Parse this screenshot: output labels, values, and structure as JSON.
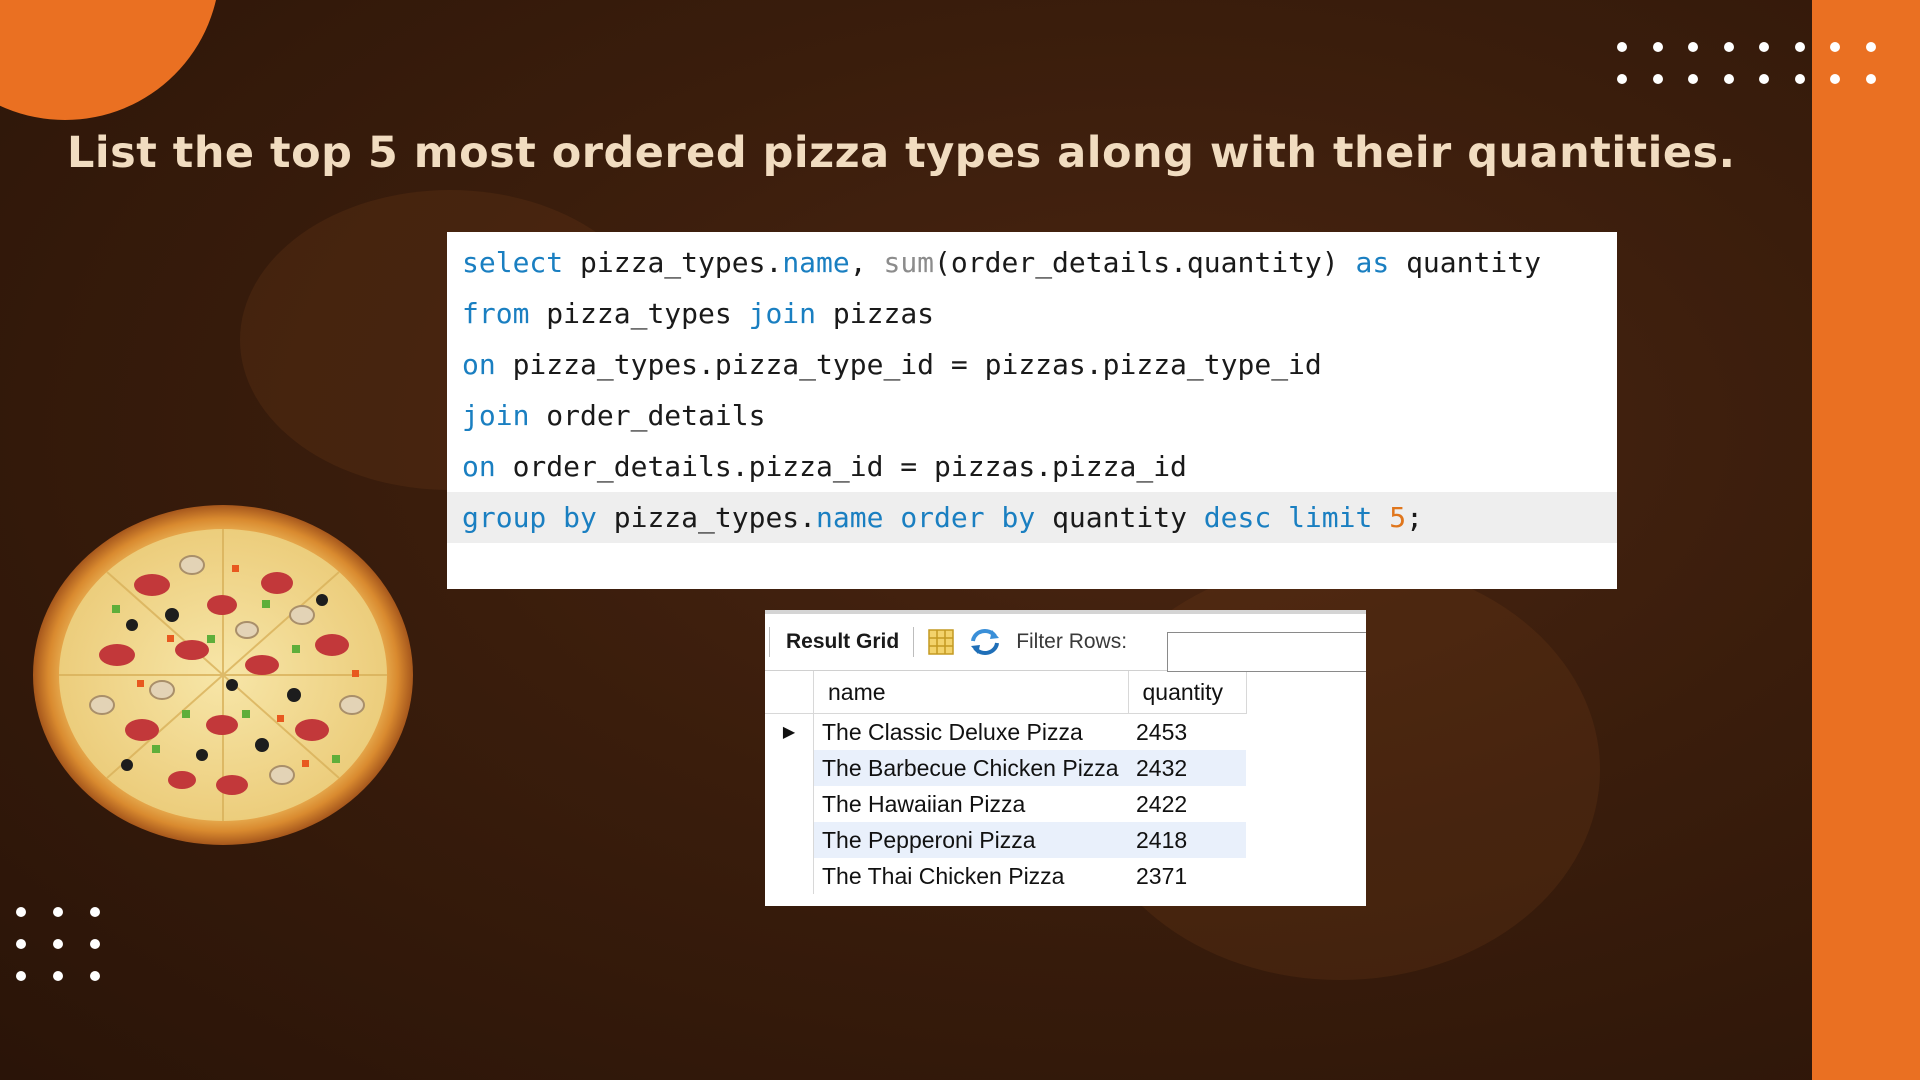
{
  "slide": {
    "title": "List the top 5 most ordered pizza types along with their quantities.",
    "accent_color": "#ea7022",
    "title_color": "#f1dcc0",
    "background_color": "#3a1d0c"
  },
  "sql_editor": {
    "lines": [
      "select pizza_types.name, sum(order_details.quantity) as quantity",
      "from pizza_types join pizzas",
      "on pizza_types.pizza_type_id = pizzas.pizza_type_id",
      "join order_details",
      "on order_details.pizza_id = pizzas.pizza_id",
      "group by pizza_types.name order by quantity desc limit 5;"
    ],
    "keyword_color": "#1a7fc1",
    "function_color": "#8c8c8c",
    "number_color": "#e0761c"
  },
  "result_grid": {
    "tab_label": "Result Grid",
    "filter_label": "Filter Rows:",
    "filter_value": "",
    "columns": [
      "name",
      "quantity"
    ],
    "rows": [
      {
        "name": "The Classic Deluxe Pizza",
        "quantity": "2453"
      },
      {
        "name": "The Barbecue Chicken Pizza",
        "quantity": "2432"
      },
      {
        "name": "The Hawaiian Pizza",
        "quantity": "2422"
      },
      {
        "name": "The Pepperoni Pizza",
        "quantity": "2418"
      },
      {
        "name": "The Thai Chicken Pizza",
        "quantity": "2371"
      }
    ],
    "icons": [
      "grid-icon",
      "refresh-icon",
      "row-pointer-icon"
    ]
  },
  "decor": {
    "image": "pizza-image"
  }
}
